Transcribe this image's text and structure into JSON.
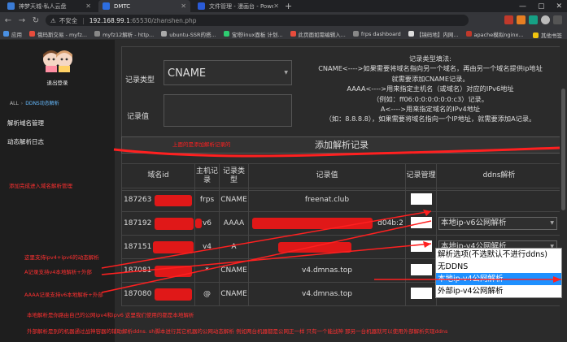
{
  "browser": {
    "tabs": [
      {
        "title": "神梦天城-私人云盘",
        "icon_color": "#3a7bd5"
      },
      {
        "title": "DMTC",
        "icon_color": "#2d6ee0"
      },
      {
        "title": "文件管理 - 漫画台 - Powered b...",
        "icon_color": "#2a5bd7"
      }
    ],
    "new_tab": "+",
    "window_controls": [
      "—",
      "▢",
      "✕"
    ],
    "address": {
      "insecure_label": "不安全",
      "host": "192.168.99.1",
      "path": ":65530/zhanshen.php"
    },
    "bookmarks": [
      "应用",
      "俄玛斯交易 - myfz...",
      "myfz12解析 - http...",
      "ubuntu-SSR的搭...",
      "宝塔linux面板 计划...",
      "此页面如需编辑入...",
      "frps dashboard",
      "【镜码地】内网...",
      "apache模拟nginx...",
      "其他书签"
    ]
  },
  "sidebar": {
    "logout": "退出登录",
    "breadcrumb": [
      "ALL",
      "DDNS动态解析"
    ],
    "nav": [
      "解析域名管理",
      "动态解析日志"
    ]
  },
  "form": {
    "type_label": "记录类型",
    "type_value": "CNAME",
    "value_label": "记录值",
    "help_lines": [
      "记录类型填法:",
      "CNAME<---->如果需要将域名指向另一个域名，再由另一个域名提供ip地址",
      "就需要添加CNAME记录。",
      "AAAA<---->用来指定主机名（或域名）对应的IPv6地址",
      "（例如：ff06:0:0:0:0:0:0:c3）记录。",
      "A<---->用来指定域名的IPv4地址",
      "（如：8.8.8.8），如果需要将域名指向一个IP地址，就需要添加A记录。"
    ],
    "submit": "添加解析记录",
    "upper_note": "上面的是添加解析记录的"
  },
  "table": {
    "headers": [
      "域名id",
      "主机记录",
      "记录类型",
      "记录值",
      "记录管理",
      "ddns解析"
    ],
    "rows": [
      {
        "id": "187263",
        "host": "frps",
        "type": "CNAME",
        "value": "freenat.club",
        "edit": "",
        "ddns": ""
      },
      {
        "id": "187192",
        "host": "v6",
        "type": "AAAA",
        "value": "d04b:2",
        "edit": "",
        "ddns": "本地ip-v6公网解析"
      },
      {
        "id": "187151",
        "host": "v4",
        "type": "A",
        "value": "",
        "edit": "",
        "ddns": "本地ip-v4公网解析"
      },
      {
        "id": "187081",
        "host": "*",
        "type": "CNAME",
        "value": "v4.dmnas.top",
        "edit": "",
        "ddns": ""
      },
      {
        "id": "187080",
        "host": "@",
        "type": "CNAME",
        "value": "v4.dmnas.top",
        "edit": "",
        "ddns": ""
      }
    ],
    "dropdown_options": [
      "解析选项(不选默认不进行ddns)",
      "无DDNS",
      "本地ip-v4公网解析",
      "外部ip-v4公网解析"
    ],
    "dropdown_selected": 2
  },
  "annotations": {
    "added": "添加完成进入域名解析管理",
    "support_v4v6": "这里支持ipv4+ipv6的动态解析",
    "a_record": "A记录支持v4本地解析+外部",
    "aaaa_record": "AAAA记录支持v6本地解析+外部",
    "local_note": "本地解析是你路由自己的公网ipv4和ipv6 这里我们使用的都是本地解析",
    "external_note": "外部解析是别的机器通过战神容器的辅助解析ddns. sh脚本进行其它机器的公网动态解析  例如两台机器都是公网正一样  只有一个能战神  那另一台机器就可以使用外部解析实现ddns"
  },
  "colors": {
    "annotation": "#ff2020",
    "dropdown_selected": "#1e90ff"
  }
}
